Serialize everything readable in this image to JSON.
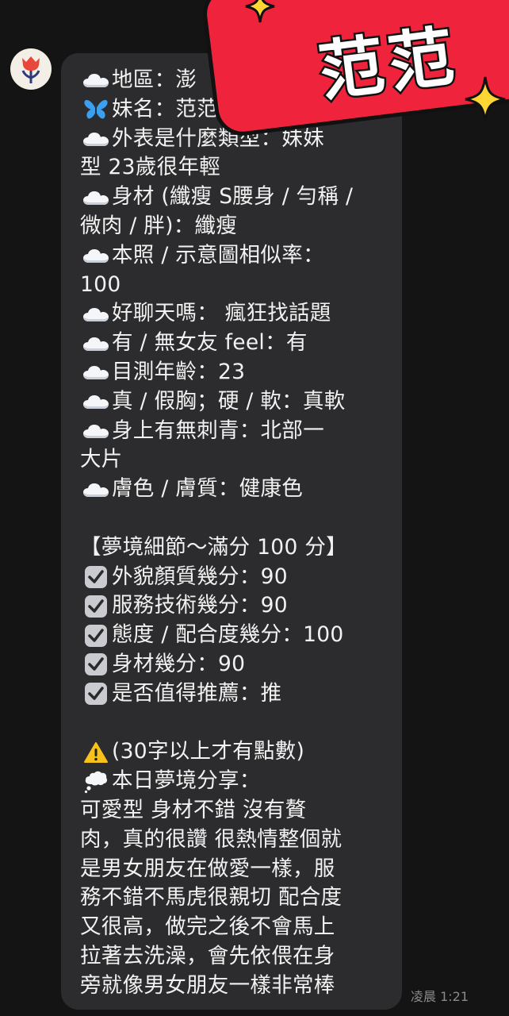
{
  "avatar": {
    "icon": "tulip-icon"
  },
  "message": {
    "lines": [
      {
        "icon": "cloud-icon",
        "text": "地區：澎"
      },
      {
        "icon": "butterfly-icon",
        "text": "妹名：范范"
      },
      {
        "icon": "cloud-icon",
        "text": " 外表是什麼類型：妹妹"
      },
      {
        "icon": "",
        "text": "型 23歲很年輕"
      },
      {
        "icon": "cloud-icon",
        "text": " 身材 (纖瘦 S腰身 / 勻稱 /"
      },
      {
        "icon": "",
        "text": "微肉 / 胖)：纖瘦"
      },
      {
        "icon": "cloud-icon",
        "text": " 本照 / 示意圖相似率："
      },
      {
        "icon": "",
        "text": "100"
      },
      {
        "icon": "cloud-icon",
        "text": " 好聊天嗎：  瘋狂找話題"
      },
      {
        "icon": "cloud-icon",
        "text": " 有 / 無女友 feel：有"
      },
      {
        "icon": "cloud-icon",
        "text": " 目測年齡：23"
      },
      {
        "icon": "cloud-icon",
        "text": " 真 / 假胸；硬 / 軟：真軟"
      },
      {
        "icon": "cloud-icon",
        "text": " 身上有無刺青：北部一"
      },
      {
        "icon": "",
        "text": "大片"
      },
      {
        "icon": "cloud-icon",
        "text": " 膚色 / 膚質：健康色"
      },
      {
        "icon": "",
        "text": ""
      },
      {
        "icon": "",
        "text": "【夢境細節～滿分 100 分】"
      },
      {
        "icon": "check-icon",
        "text": " 外貌顏質幾分：90"
      },
      {
        "icon": "check-icon",
        "text": " 服務技術幾分：90"
      },
      {
        "icon": "check-icon",
        "text": " 態度 / 配合度幾分：100"
      },
      {
        "icon": "check-icon",
        "text": " 身材幾分：90"
      },
      {
        "icon": "check-icon",
        "text": " 是否值得推薦：推"
      },
      {
        "icon": "",
        "text": ""
      },
      {
        "icon": "warning-icon",
        "text": "(30字以上才有點數)"
      },
      {
        "icon": "thought-bubble-icon",
        "text": "本日夢境分享："
      },
      {
        "icon": "",
        "text": "可愛型 身材不錯 沒有贅"
      },
      {
        "icon": "",
        "text": "肉，真的很讚 很熱情整個就"
      },
      {
        "icon": "",
        "text": "是男女朋友在做愛一樣，服"
      },
      {
        "icon": "",
        "text": "務不錯不馬虎很親切 配合度"
      },
      {
        "icon": "",
        "text": "又很高，做完之後不會馬上"
      },
      {
        "icon": "",
        "text": "拉著去洗澡，會先依偎在身"
      },
      {
        "icon": "",
        "text": "旁就像男女朋友一樣非常棒"
      }
    ]
  },
  "timestamp": "凌晨 1:21",
  "name_badge": {
    "text": "范范",
    "color": "#f0233d"
  }
}
